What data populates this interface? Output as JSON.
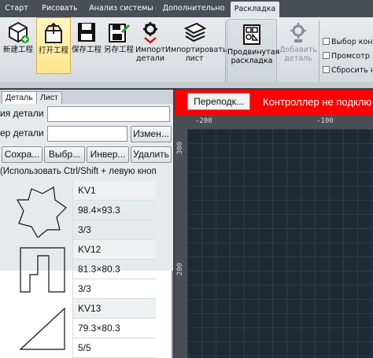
{
  "ribbon_tabs": [
    "Старт",
    "Рисовать",
    "Анализ системы",
    "Дополнительно",
    "Раскладка"
  ],
  "toolbar": {
    "new_project": "新建工程",
    "open_project": "打开工程",
    "save_project": "保存工程",
    "save_as_project": "另存工程",
    "import_detail_1": "Импорт",
    "import_detail_2": "детали",
    "import_sheet_1": "Импортировать",
    "import_sheet_2": "лист",
    "advanced_layout_1": "Продвинутая",
    "advanced_layout_2": "раскладка",
    "add_detail_1": "Добавить",
    "add_detail_2": "деталь",
    "select_shape": "Выбор конт",
    "preview": "Промсотр",
    "reset": "Сбросить на"
  },
  "panel": {
    "tabs": [
      "Деталь",
      "Лист"
    ],
    "name_label": "ия детали",
    "num_label": "ер детали",
    "name_value": "",
    "num_value": "",
    "change_btn": "Измен...",
    "save_btn": "Сохра...",
    "select_btn": "Выбр...",
    "invert_btn": "Инвер...",
    "delete_btn": "Удалить",
    "hint": "(Использовать Ctrl/Shift + левую кноп"
  },
  "parts": [
    {
      "name": "KV1",
      "size": "98.4×93.3",
      "qty": "3/3",
      "shape": "star-hexagon"
    },
    {
      "name": "KV12",
      "size": "81.3×80.3",
      "qty": "3/3",
      "shape": "stepped"
    },
    {
      "name": "KV13",
      "size": "79.3×80.3",
      "qty": "5/5",
      "shape": "triangle"
    }
  ],
  "canvas": {
    "jump_btn": "Переподк...",
    "controller_msg": "Контроллер не подклю",
    "ruler_x": [
      "-200",
      "-100"
    ],
    "ruler_y": [
      "300",
      "200"
    ]
  },
  "colors": {
    "alert": "#ff0000",
    "canvas_bg": "#1d2a36",
    "highlight": "#ffe48a"
  }
}
